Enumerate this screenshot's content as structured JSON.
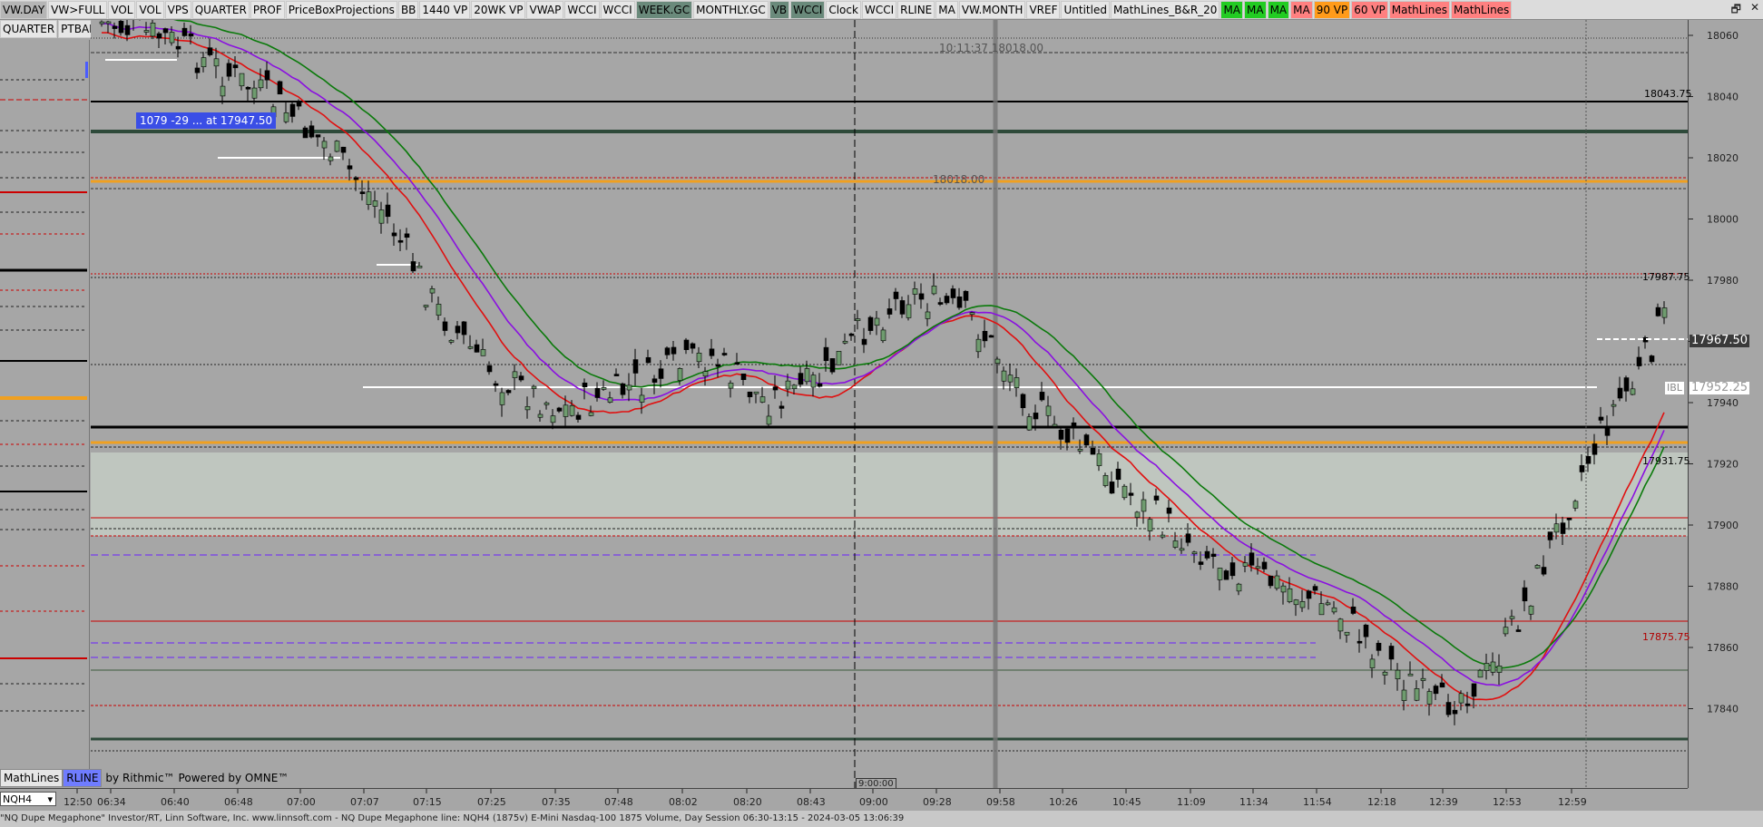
{
  "toolbar": {
    "items": [
      {
        "label": "VW.DAY",
        "style": "gray"
      },
      {
        "label": "VW>FULL",
        "style": "normal"
      },
      {
        "label": "VOL",
        "style": "normal"
      },
      {
        "label": "VOL",
        "style": "normal"
      },
      {
        "label": "VPS",
        "style": "normal"
      },
      {
        "label": "QUARTER",
        "style": "normal"
      },
      {
        "label": "PROF",
        "style": "normal"
      },
      {
        "label": "PriceBoxProjections",
        "style": "normal"
      },
      {
        "label": "BB",
        "style": "normal"
      },
      {
        "label": "1440 VP",
        "style": "normal"
      },
      {
        "label": "20WK VP",
        "style": "normal"
      },
      {
        "label": "VWAP",
        "style": "normal"
      },
      {
        "label": "WCCI",
        "style": "normal"
      },
      {
        "label": "WCCI",
        "style": "normal"
      },
      {
        "label": "WEEK.GC",
        "style": "active"
      },
      {
        "label": "MONTHLY.GC",
        "style": "normal"
      },
      {
        "label": "VB",
        "style": "active"
      },
      {
        "label": "WCCI",
        "style": "active"
      },
      {
        "label": "Clock",
        "style": "normal"
      },
      {
        "label": "WCCI",
        "style": "normal"
      },
      {
        "label": "RLINE",
        "style": "normal"
      },
      {
        "label": "MA",
        "style": "normal"
      },
      {
        "label": "VW.MONTH",
        "style": "normal"
      },
      {
        "label": "VREF",
        "style": "normal"
      },
      {
        "label": "Untitled",
        "style": "normal"
      },
      {
        "label": "MathLines_B&R_20",
        "style": "normal"
      },
      {
        "label": "MA",
        "style": "green"
      },
      {
        "label": "MA",
        "style": "green"
      },
      {
        "label": "MA",
        "style": "green"
      },
      {
        "label": "MA",
        "style": "red"
      },
      {
        "label": "90 VP",
        "style": "orange"
      },
      {
        "label": "60 VP",
        "style": "red"
      },
      {
        "label": "MathLines",
        "style": "red"
      },
      {
        "label": "MathLines",
        "style": "red"
      }
    ],
    "win_restore": "🗗",
    "win_close": "✕"
  },
  "subbar": {
    "quarter": "QUARTER",
    "ptbar": "PTBAR"
  },
  "overlay_label": "1079  -29 ... at 17947.50",
  "clock_text": "10:11:37  18018.00",
  "mid_label": "18018.00",
  "time_marker": "9:00:00",
  "bottom_tabs": {
    "mathlines": "MathLines",
    "rline": "RLINE",
    "rithmic": "by Rithmic™",
    "omne": "Powered by OMNE™"
  },
  "symbol": "NQH4",
  "status": "\"NQ Dupe Megaphone\" Investor/RT, Linn Software, Inc. www.linnsoft.com - NQ Dupe Megaphone line: NQH4 (1875v) E-Mini Nasdaq-100 1875 Volume, Day Session 06:30-13:15 - 2024-03-05 13:06:39",
  "axis": {
    "price_ticks": [
      "18060",
      "18040",
      "18020",
      "18000",
      "17980",
      "17960",
      "17940",
      "17920",
      "17900",
      "17880",
      "17860",
      "17840"
    ],
    "time_ticks": [
      "12:50",
      "06:34",
      "06:40",
      "06:48",
      "07:00",
      "07:07",
      "07:15",
      "07:25",
      "07:35",
      "07:48",
      "08:02",
      "08:20",
      "08:43",
      "09:00",
      "09:28",
      "09:58",
      "10:26",
      "10:45",
      "11:09",
      "11:34",
      "11:54",
      "12:18",
      "12:39",
      "12:53",
      "12:59"
    ]
  },
  "price_labels": {
    "l1": "18043.75",
    "l2": "17987.75",
    "l3": "17931.75",
    "l4": "17875.75",
    "last": "17967.50",
    "ibl_tag": "IBL",
    "ibl": "17952.25"
  },
  "colors": {
    "ma_green": "#0b7a0b",
    "ma_purple": "#8a10e0",
    "ma_red": "#e01010",
    "orange": "#f0a020",
    "band": "#bfc6bf"
  }
}
